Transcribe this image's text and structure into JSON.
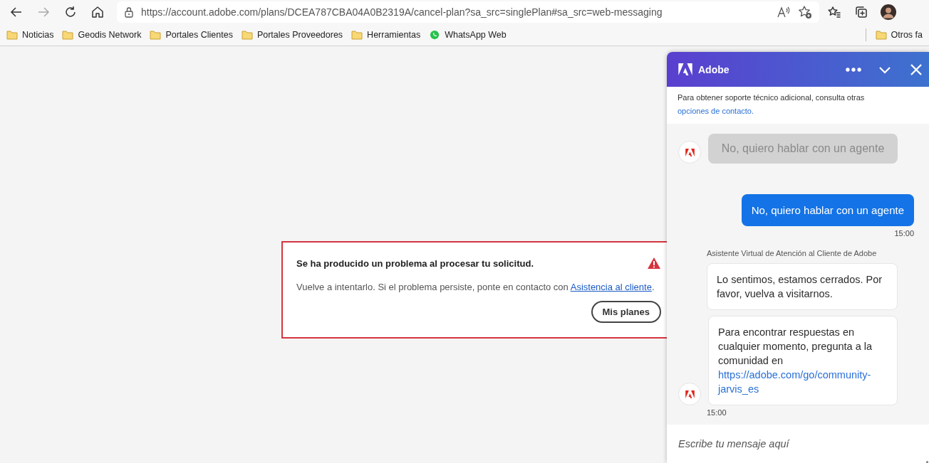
{
  "browser": {
    "url": "https://account.adobe.com/plans/DCEA787CBA04A0B2319A/cancel-plan?sa_src=singlePlan#sa_src=web-messaging",
    "bookmarks": [
      {
        "label": "Noticias",
        "kind": "folder"
      },
      {
        "label": "Geodis Network",
        "kind": "folder"
      },
      {
        "label": "Portales Clientes",
        "kind": "folder"
      },
      {
        "label": "Portales Proveedores",
        "kind": "folder"
      },
      {
        "label": "Herramientas",
        "kind": "folder"
      },
      {
        "label": "WhatsApp Web",
        "kind": "site"
      }
    ],
    "other_bookmarks": "Otros fa"
  },
  "error_card": {
    "title": "Se ha producido un problema al procesar tu solicitud.",
    "message": "Vuelve a intentarlo. Si el problema persiste, ponte en contacto con",
    "link": "Asistencia al cliente",
    "after_link": ".",
    "button": "Mis planes"
  },
  "chat": {
    "title": "Adobe",
    "notice": "Para obtener soporte técnico adicional, consulta otras",
    "notice_link": "opciones de contacto.",
    "messages": [
      {
        "kind": "option",
        "text": "No, quiero hablar con un agente",
        "disabled": true
      },
      {
        "kind": "user",
        "text": "No, quiero hablar con un agente",
        "time": "15:00"
      },
      {
        "kind": "sender",
        "text": "Asistente Virtual de Atención al Cliente de Adobe"
      },
      {
        "kind": "bot",
        "text": "Lo sentimos, estamos cerrados. Por favor, vuelva a visitarnos."
      },
      {
        "kind": "bot",
        "text": "Para encontrar respuestas en cualquier momento, pregunta a la comunidad en",
        "link": "https://adobe.com/go/community-jarvis_es",
        "avatar": true,
        "time": "15:00"
      }
    ],
    "input_placeholder": "Escribe tu mensaje aquí"
  }
}
